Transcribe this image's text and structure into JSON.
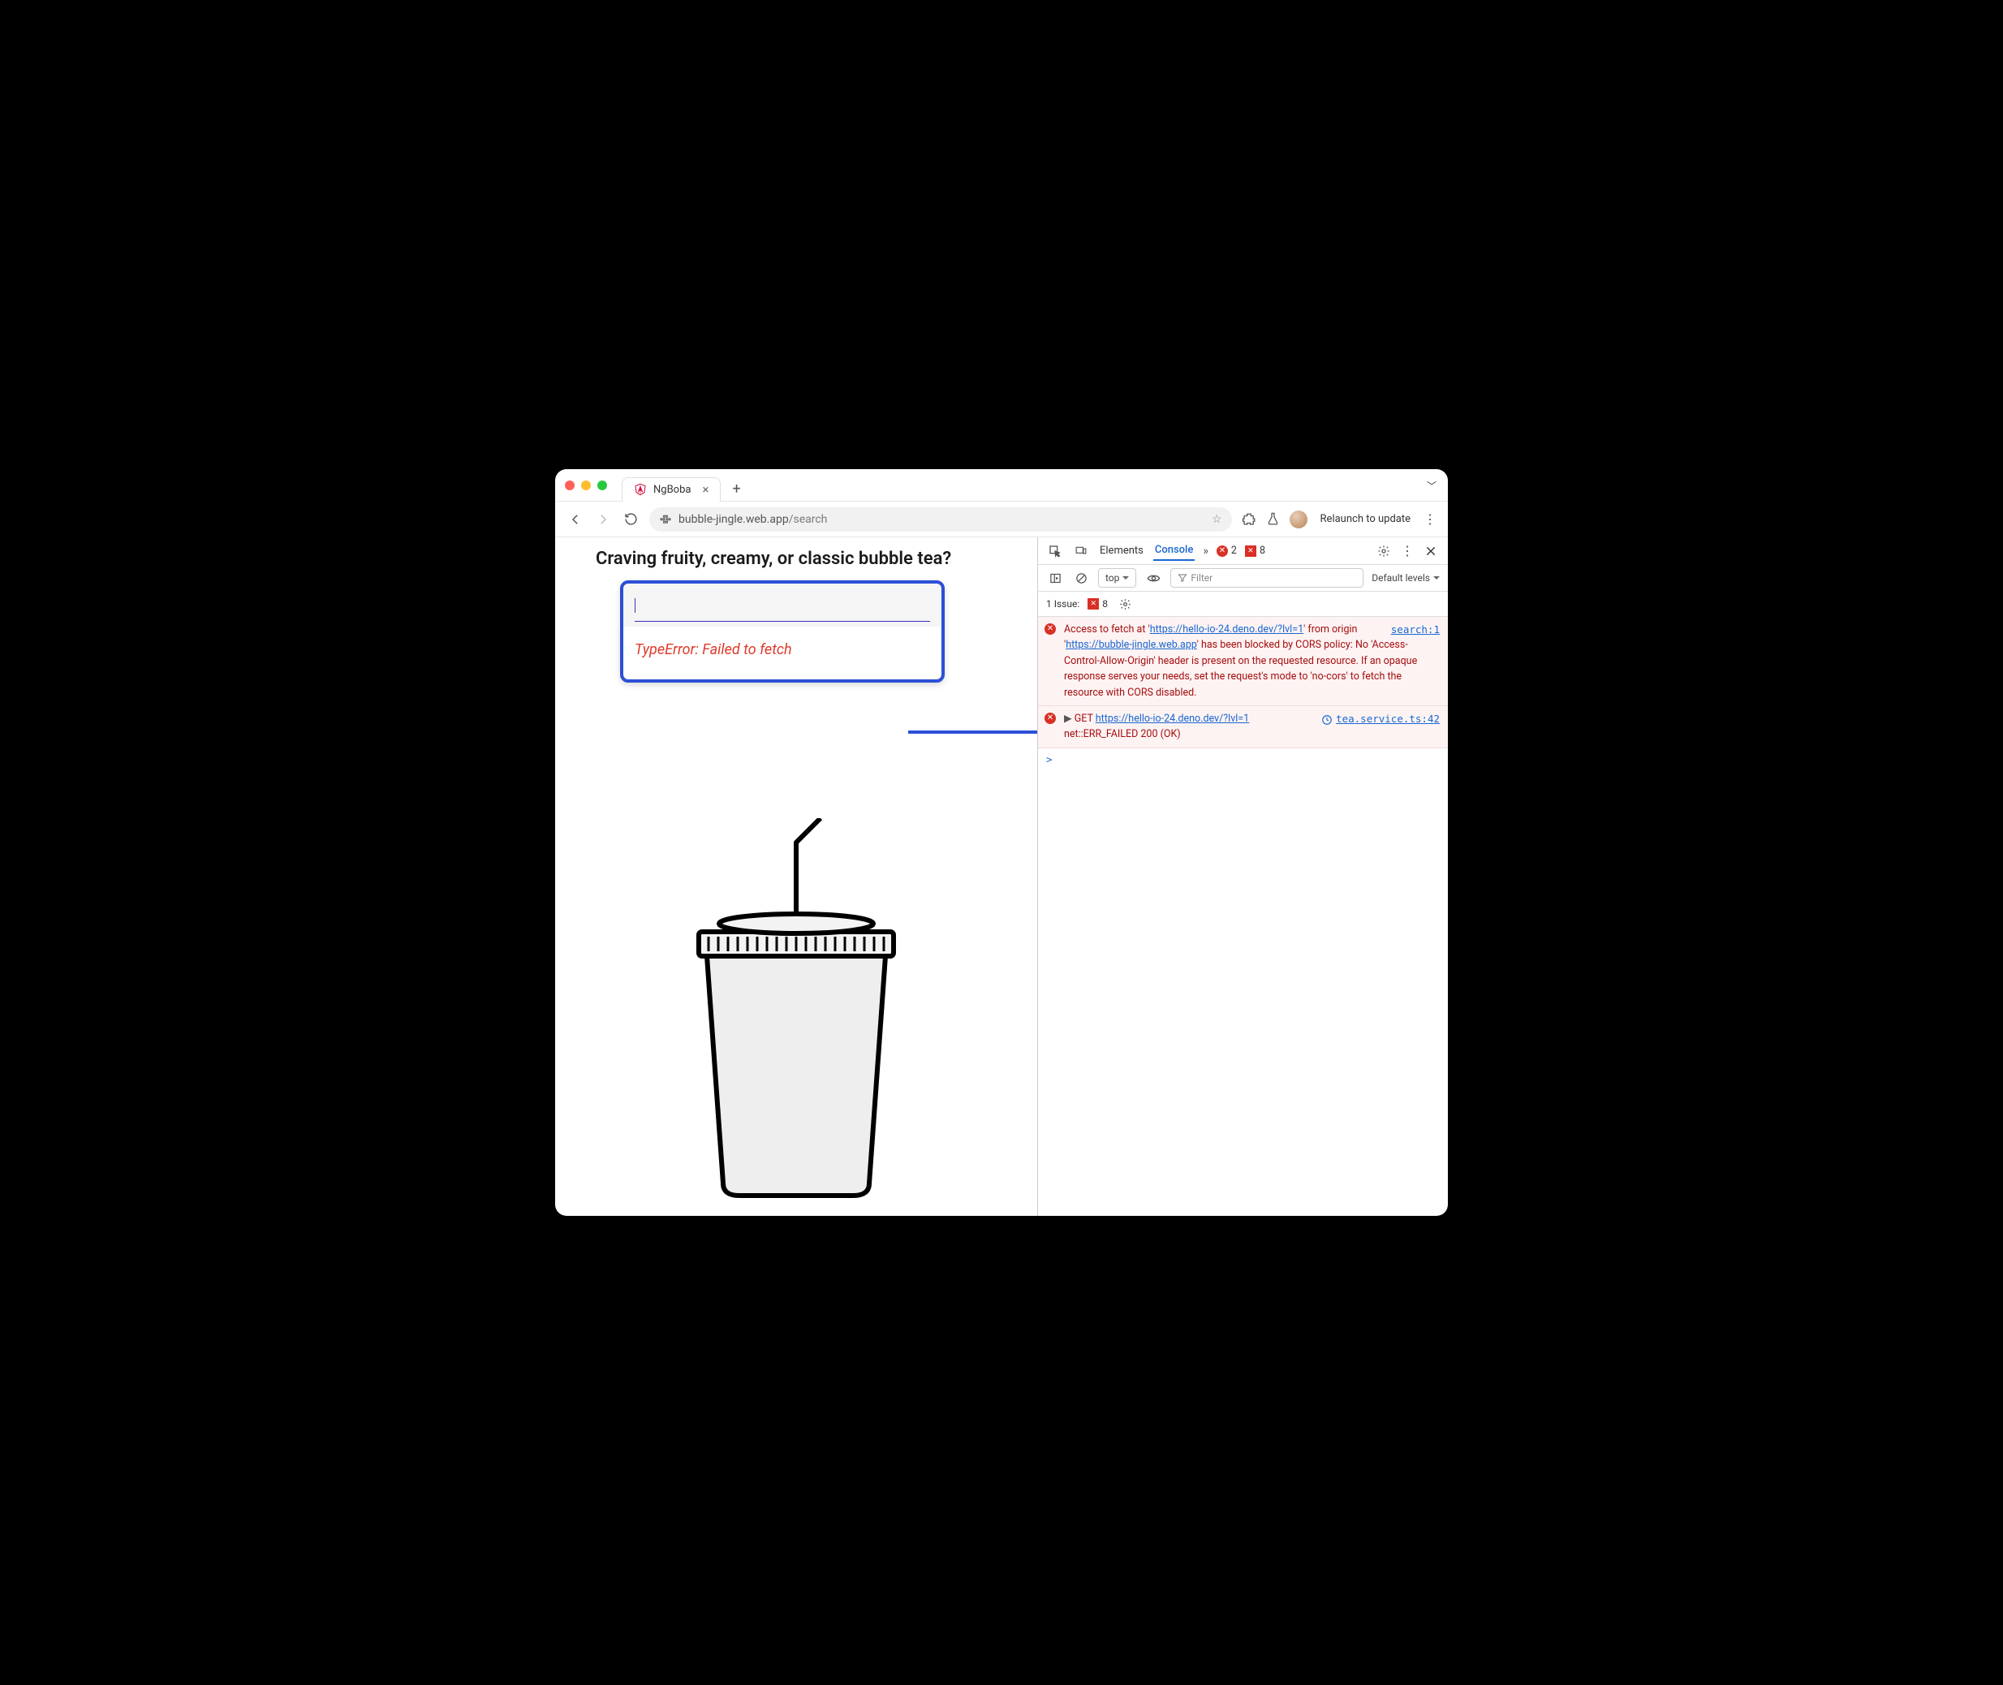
{
  "browser": {
    "tab_title": "NgBoba",
    "url_host": "bubble-jingle.web.app",
    "url_path": "/search",
    "relaunch_label": "Relaunch to update"
  },
  "page": {
    "heading": "Craving fruity, creamy, or classic bubble tea?",
    "search_value": "",
    "error_message": "TypeError: Failed to fetch"
  },
  "devtools": {
    "tabs": {
      "elements": "Elements",
      "console": "Console"
    },
    "error_count": "2",
    "issue_count": "8",
    "context_label": "top",
    "filter_placeholder": "Filter",
    "levels_label": "Default levels",
    "issues_label": "1 Issue:",
    "issues_badge": "8",
    "messages": [
      {
        "source": "search:1",
        "pre1": "Access to fetch at '",
        "link1": "https://hello-io-24.deno.dev/?lvl=1",
        "mid1": "' from origin '",
        "link2": "https://bubble-jingle.web.app",
        "post": "' has been blocked by CORS policy: No 'Access-Control-Allow-Origin' header is present on the requested resource. If an opaque response serves your needs, set the request's mode to 'no-cors' to fetch the resource with CORS disabled."
      },
      {
        "source": "tea.service.ts:42",
        "method": "GET",
        "link": "https://hello-io-24.deno.dev/?lvl=1",
        "tail": " net::ERR_FAILED 200 (OK)"
      }
    ],
    "prompt": ">"
  }
}
